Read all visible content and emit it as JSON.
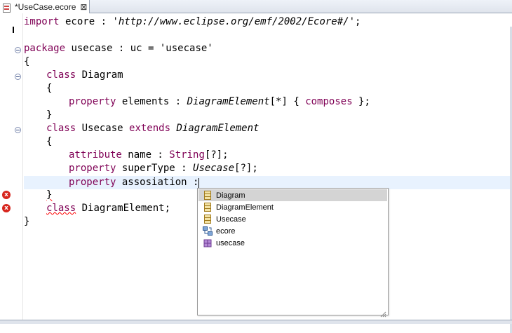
{
  "tab": {
    "label": "*UseCase.ecore",
    "close": "⊠"
  },
  "code": {
    "l1": {
      "kw": "import",
      "rest": " ecore : ",
      "str": "'http://www.eclipse.org/emf/2002/Ecore#/'",
      "end": ";"
    },
    "l3": {
      "kw": "package",
      "rest": " usecase : uc = ",
      "str": "'usecase'"
    },
    "l4": "{",
    "l5": {
      "kw": "class",
      "name": " Diagram"
    },
    "l6": "{",
    "l7": {
      "kw": "property",
      "rest": " elements : ",
      "type": "DiagramElement",
      "mid": "[*] { ",
      "kw2": "composes",
      "end": " };"
    },
    "l8": "}",
    "l9": {
      "kw": "class",
      "name": " Usecase ",
      "kw2": "extends",
      "type": " DiagramElement"
    },
    "l10": "{",
    "l11": {
      "kw": "attribute",
      "rest": " name : ",
      "type": "String",
      "end": "[?];"
    },
    "l12": {
      "kw": "property",
      "rest": " superType : ",
      "type": "Usecase",
      "end": "[?];"
    },
    "l13": {
      "kw": "property",
      "rest": " assosiation : "
    },
    "l14": "}",
    "l15": {
      "kw": "class",
      "name": " DiagramElement;"
    },
    "l16": "}"
  },
  "error_markers": {
    "icon": "x"
  },
  "completion": {
    "items": [
      {
        "label": "Diagram",
        "icon": "class-icon",
        "selected": true
      },
      {
        "label": "DiagramElement",
        "icon": "class-icon",
        "selected": false
      },
      {
        "label": "Usecase",
        "icon": "class-icon",
        "selected": false
      },
      {
        "label": "ecore",
        "icon": "imported-package-icon",
        "selected": false
      },
      {
        "label": "usecase",
        "icon": "package-icon",
        "selected": false
      }
    ]
  }
}
